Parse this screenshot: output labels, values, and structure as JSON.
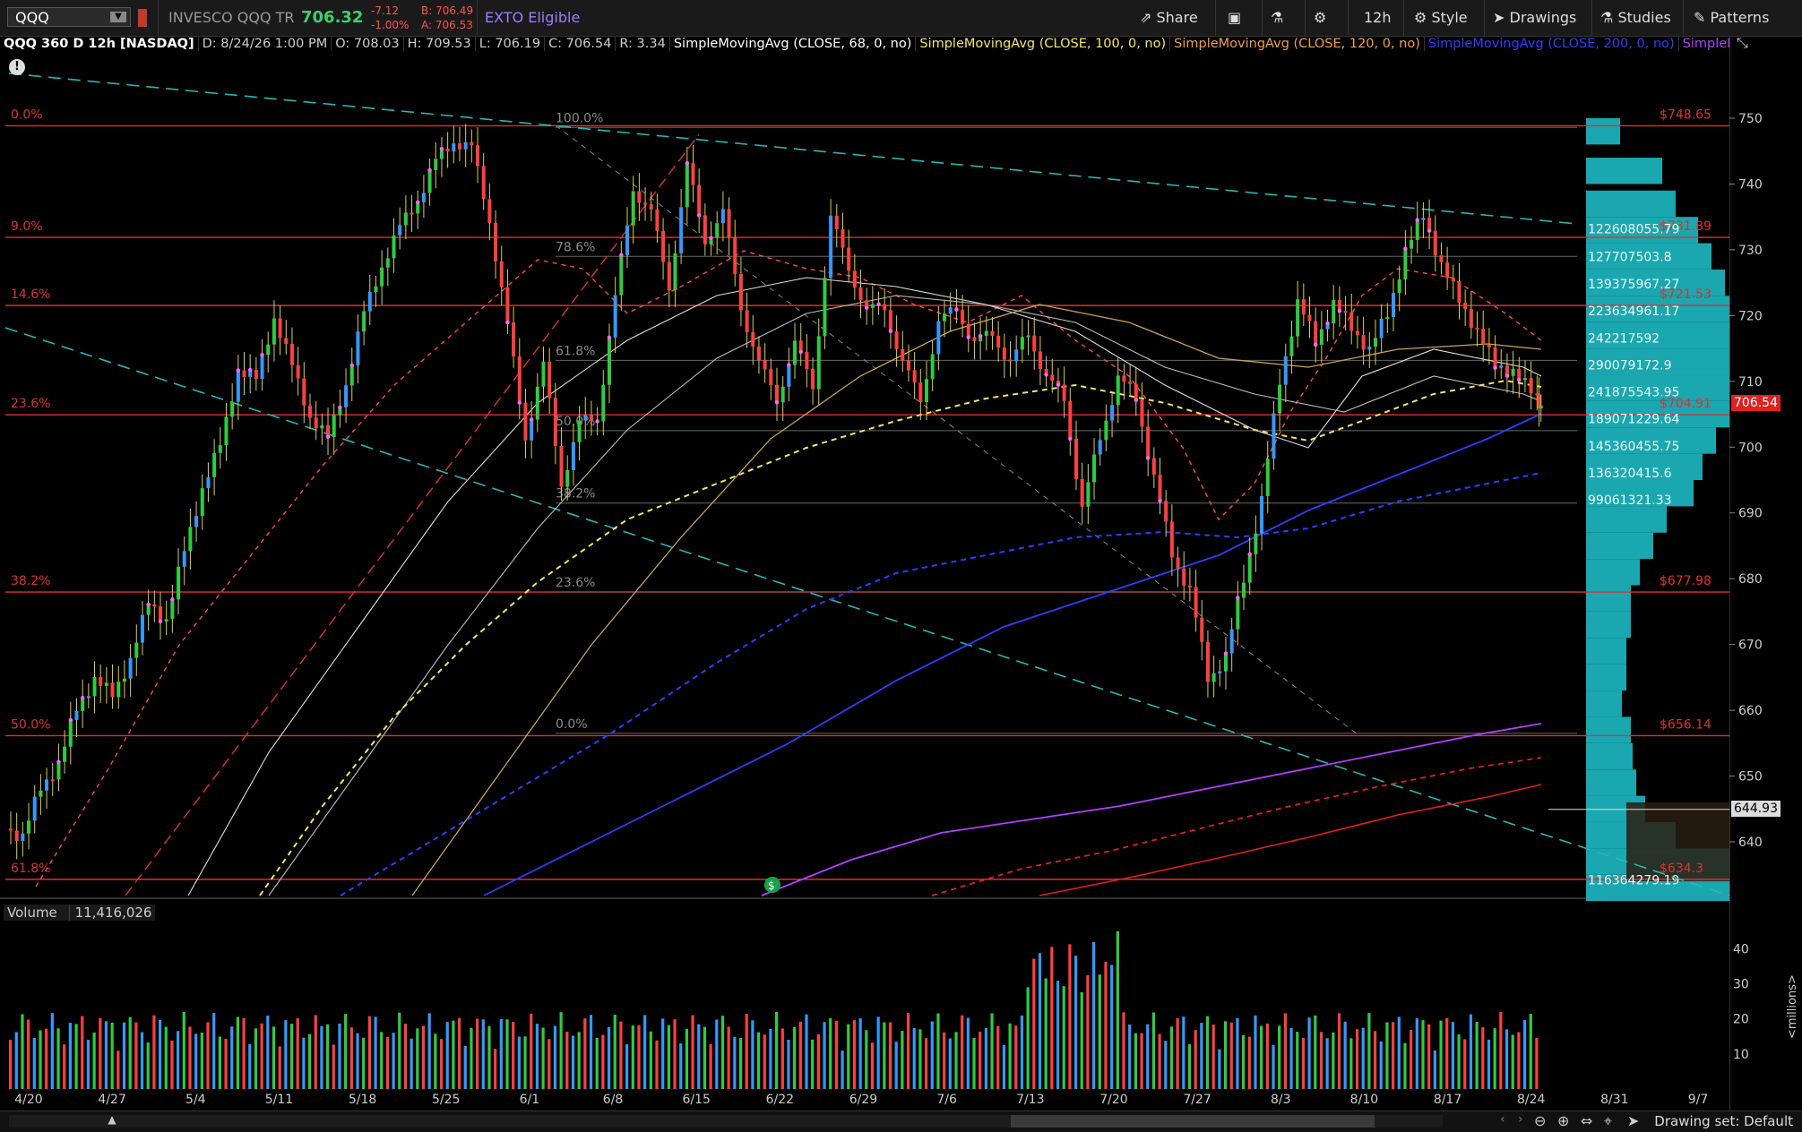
{
  "toolbar": {
    "symbol": "QQQ",
    "description": "INVESCO QQQ TR",
    "last": "706.32",
    "change": "-7.12",
    "change_pct": "-1.00%",
    "bid": "B: 706.49",
    "ask": "A: 706.53",
    "exto": "EXTO Eligible",
    "share": "Share",
    "aggregation": "12h",
    "style": "Style",
    "drawings": "Drawings",
    "studies": "Studies",
    "patterns": "Patterns"
  },
  "studybar": {
    "title": "QQQ 360 D 12h [NASDAQ]",
    "date": "D: 8/24/26 1:00 PM",
    "open": "O: 708.03",
    "high": "H: 709.53",
    "low": "L: 706.19",
    "close": "C: 706.54",
    "range": "R: 3.34",
    "sma68": "SimpleMovingAvg (CLOSE, 68, 0, no)",
    "sma100": "SimpleMovingAvg (CLOSE, 100, 0, no)",
    "sma120": "SimpleMovingAvg (CLOSE, 120, 0, no)",
    "sma200": "SimpleMovingAvg (CLOSE, 200, 0, no)",
    "sma_more": "SimpleMoving..."
  },
  "volume": {
    "label": "Volume",
    "value": "11,416,026"
  },
  "bottom": {
    "drawing_set": "Drawing set: Default"
  },
  "last_price_tag": "706.54",
  "cursor_price_tag": "644.93",
  "colors": {
    "up": "#2ecc40",
    "down": "#ff4040",
    "neutral_up": "#3399ff",
    "fib": "#e03030",
    "trend": "#2bb5b5",
    "volume_profile": "#1aa7b0"
  },
  "chart_data": {
    "type": "candlestick",
    "ylim": [
      633,
      752
    ],
    "yticks": [
      640,
      650,
      660,
      670,
      680,
      690,
      700,
      710,
      720,
      730,
      740,
      750
    ],
    "volume_ylim": [
      0,
      48
    ],
    "volume_ticks": [
      10,
      20,
      30,
      40
    ],
    "volume_unit": "<millions>",
    "x_labels": [
      "4/20",
      "4/27",
      "5/4",
      "5/11",
      "5/18",
      "5/25",
      "6/1",
      "6/8",
      "6/15",
      "6/22",
      "6/29",
      "7/6",
      "7/13",
      "7/20",
      "7/27",
      "8/3",
      "8/10",
      "8/17",
      "8/24",
      "8/31",
      "9/7"
    ],
    "close_path": [
      [
        0,
        642
      ],
      [
        3,
        641
      ],
      [
        6,
        648
      ],
      [
        9,
        652
      ],
      [
        12,
        660
      ],
      [
        15,
        665
      ],
      [
        18,
        662
      ],
      [
        21,
        668
      ],
      [
        24,
        676
      ],
      [
        27,
        674
      ],
      [
        30,
        684
      ],
      [
        33,
        694
      ],
      [
        36,
        700
      ],
      [
        39,
        712
      ],
      [
        42,
        710
      ],
      [
        45,
        720
      ],
      [
        48,
        712
      ],
      [
        51,
        705
      ],
      [
        54,
        701
      ],
      [
        57,
        710
      ],
      [
        60,
        720
      ],
      [
        63,
        728
      ],
      [
        66,
        733
      ],
      [
        69,
        738
      ],
      [
        72,
        743
      ],
      [
        75,
        747
      ],
      [
        78,
        745
      ],
      [
        81,
        735
      ],
      [
        84,
        718
      ],
      [
        87,
        702
      ],
      [
        90,
        712
      ],
      [
        93,
        695
      ],
      [
        96,
        703
      ],
      [
        99,
        705
      ],
      [
        102,
        722
      ],
      [
        105,
        740
      ],
      [
        108,
        735
      ],
      [
        111,
        725
      ],
      [
        114,
        742
      ],
      [
        117,
        732
      ],
      [
        120,
        735
      ],
      [
        123,
        722
      ],
      [
        126,
        712
      ],
      [
        129,
        708
      ],
      [
        132,
        715
      ],
      [
        135,
        710
      ],
      [
        138,
        734
      ],
      [
        141,
        728
      ],
      [
        144,
        720
      ],
      [
        147,
        722
      ],
      [
        150,
        712
      ],
      [
        153,
        708
      ],
      [
        156,
        718
      ],
      [
        159,
        722
      ],
      [
        162,
        715
      ],
      [
        165,
        718
      ],
      [
        168,
        712
      ],
      [
        171,
        718
      ],
      [
        174,
        710
      ],
      [
        177,
        708
      ],
      [
        180,
        690
      ],
      [
        183,
        702
      ],
      [
        186,
        710
      ],
      [
        189,
        708
      ],
      [
        192,
        695
      ],
      [
        195,
        684
      ],
      [
        198,
        678
      ],
      [
        201,
        665
      ],
      [
        204,
        668
      ],
      [
        207,
        680
      ],
      [
        210,
        692
      ],
      [
        213,
        710
      ],
      [
        216,
        722
      ],
      [
        219,
        716
      ],
      [
        222,
        722
      ],
      [
        225,
        718
      ],
      [
        228,
        715
      ],
      [
        231,
        720
      ],
      [
        234,
        730
      ],
      [
        237,
        735
      ],
      [
        240,
        728
      ],
      [
        243,
        722
      ],
      [
        246,
        718
      ],
      [
        249,
        712
      ],
      [
        252,
        712
      ],
      [
        255,
        708
      ],
      [
        256,
        706.54
      ]
    ],
    "fib_levels": [
      {
        "pct": "0.0%",
        "price": 748.85,
        "label": "$748.65"
      },
      {
        "pct": "9.0%",
        "price": 731.89,
        "label": "$731.89"
      },
      {
        "pct": "14.6%",
        "price": 721.53,
        "label": "$721.53"
      },
      {
        "pct": "23.6%",
        "price": 704.91,
        "label": "$704.91"
      },
      {
        "pct": "38.2%",
        "price": 677.98,
        "label": "$677.98"
      },
      {
        "pct": "50.0%",
        "price": 656.14,
        "label": "$656.14"
      },
      {
        "pct": "61.8%",
        "price": 634.3,
        "label": "$634.3"
      }
    ],
    "fib_retrace_inner": [
      {
        "pct": "100.0%",
        "price": 748.6
      },
      {
        "pct": "78.6%",
        "price": 729.0
      },
      {
        "pct": "61.8%",
        "price": 713.2
      },
      {
        "pct": "50.0%",
        "price": 702.5
      },
      {
        "pct": "38.2%",
        "price": 691.5
      },
      {
        "pct": "23.6%",
        "price": 678.0
      },
      {
        "pct": "0.0%",
        "price": 656.5
      }
    ],
    "volume_profile_labels": [
      {
        "price": 733.2,
        "label": "122608055.79"
      },
      {
        "price": 729.0,
        "label": "127707503.8"
      },
      {
        "price": 724.8,
        "label": "139375967.27"
      },
      {
        "price": 720.7,
        "label": "223634961.17"
      },
      {
        "price": 716.6,
        "label": "242217592"
      },
      {
        "price": 712.5,
        "label": "290079172.9"
      },
      {
        "price": 708.4,
        "label": "241875543.95"
      },
      {
        "price": 704.3,
        "label": "189071229.64"
      },
      {
        "price": 700.2,
        "label": "145360455.75"
      },
      {
        "price": 696.1,
        "label": "136320415.6"
      },
      {
        "price": 692.0,
        "label": "99061321.33"
      },
      {
        "price": 634.2,
        "label": "116364279.19"
      }
    ]
  }
}
